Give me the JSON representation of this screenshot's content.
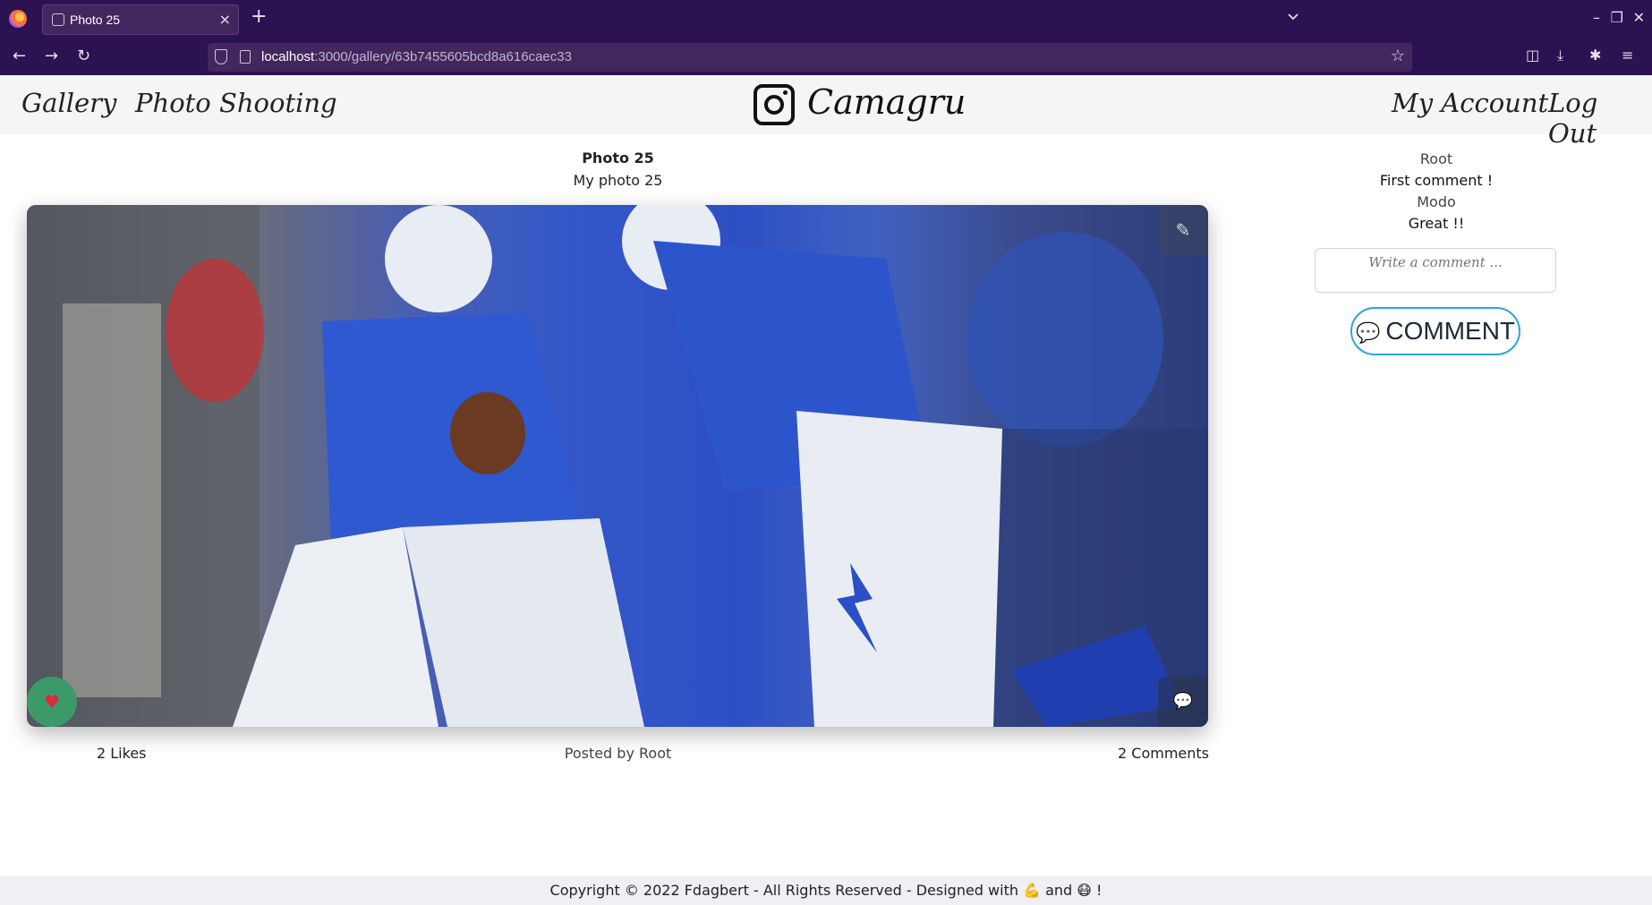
{
  "browser": {
    "tab_title": "Photo 25",
    "tab_close": "×",
    "new_tab": "+",
    "url_host": "localhost",
    "url_rest": ":3000/gallery/63b7455605bcd8a616caec33"
  },
  "header": {
    "nav_left": [
      "Gallery",
      "Photo Shooting"
    ],
    "brand": "Camagru",
    "nav_right": [
      "My Account",
      "Log Out"
    ]
  },
  "photo": {
    "title": "Photo 25",
    "description": "My photo 25",
    "likes_label": "2 Likes",
    "posted_by": "Posted by Root",
    "comments_label": "2 Comments"
  },
  "comments": [
    {
      "author": "Root",
      "text": "First comment !"
    },
    {
      "author": "Modo",
      "text": "Great !!"
    }
  ],
  "comment_form": {
    "placeholder": "Write a comment ...",
    "submit_label": "COMMENT"
  },
  "icons": {
    "tool": "wrench-icon",
    "like": "heart-icon",
    "comment": "comment-icon"
  },
  "footer": {
    "text": "Copyright © 2022 Fdagbert - All Rights Reserved - Designed with 💪 and 😷 !"
  }
}
